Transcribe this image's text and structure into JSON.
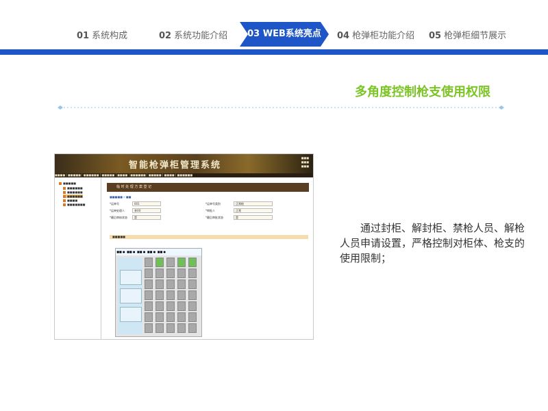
{
  "nav": {
    "items": [
      {
        "num": "01",
        "label": "系统构成"
      },
      {
        "num": "02",
        "label": "系统功能介绍"
      },
      {
        "num": "03",
        "label": "WEB系统亮点"
      },
      {
        "num": "04",
        "label": "枪弹柜功能介绍"
      },
      {
        "num": "05",
        "label": "枪弹柜细节展示"
      }
    ],
    "active_index": 2,
    "colors": {
      "active_bg": "#1e56c8",
      "bar": "#1e56c8"
    }
  },
  "section_title": "多角度控制枪支使用权限",
  "screenshot": {
    "app_title": "智能枪弹柜管理系统",
    "panel_title": "临 时 处 理 方 案 登 记",
    "form_fields": [
      {
        "label": "*运单号",
        "value": "001"
      },
      {
        "label": "*运单号类别",
        "value": "正常枪"
      },
      {
        "label": "*运单处理人",
        "value": "李XX"
      },
      {
        "label": "*审批人",
        "value": "正常"
      },
      {
        "label": "*最后审核状态",
        "value": "是"
      },
      {
        "label": "*最后审批状态",
        "value": "是"
      }
    ]
  },
  "description": "通过封柜、解封柜、禁枪人员、解枪人员申请设置，严格控制对柜体、枪支的使用限制；"
}
